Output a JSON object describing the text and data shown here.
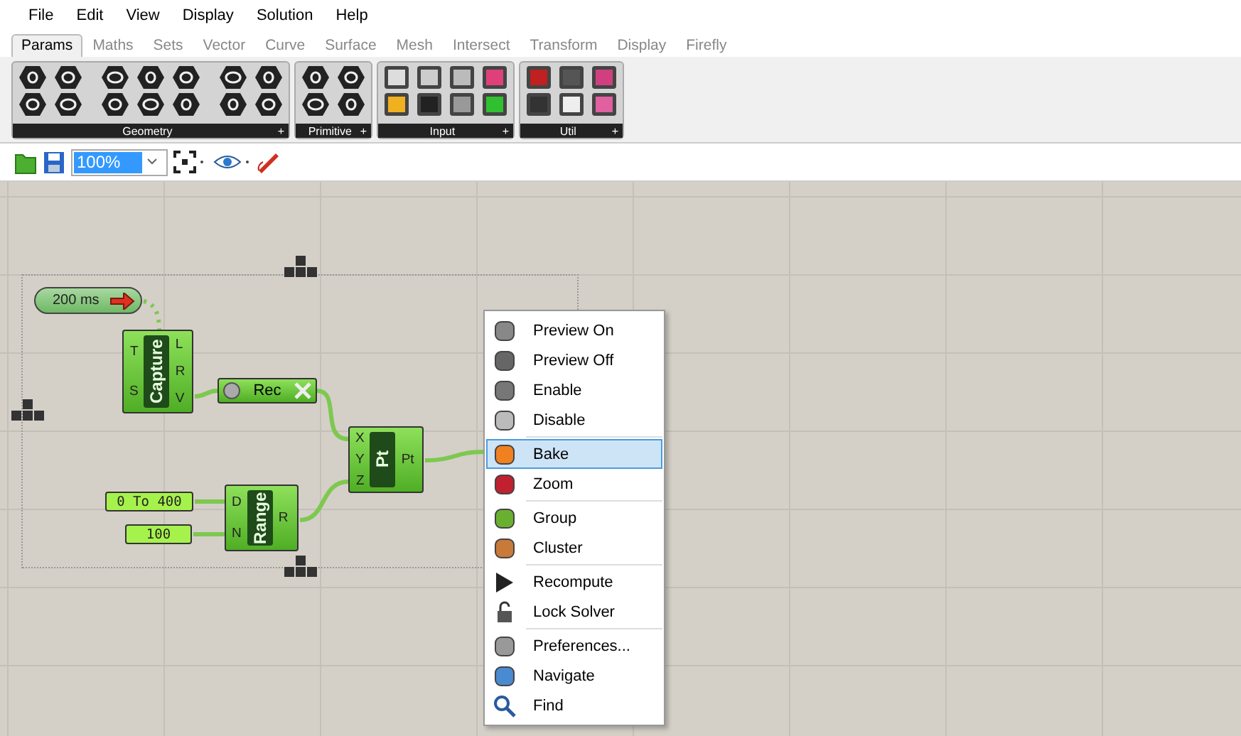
{
  "menu_bar": [
    "File",
    "Edit",
    "View",
    "Display",
    "Solution",
    "Help"
  ],
  "tabs": [
    {
      "label": "Params",
      "selected": true
    },
    {
      "label": "Maths",
      "selected": false
    },
    {
      "label": "Sets",
      "selected": false
    },
    {
      "label": "Vector",
      "selected": false
    },
    {
      "label": "Curve",
      "selected": false
    },
    {
      "label": "Surface",
      "selected": false
    },
    {
      "label": "Mesh",
      "selected": false
    },
    {
      "label": "Intersect",
      "selected": false
    },
    {
      "label": "Transform",
      "selected": false
    },
    {
      "label": "Display",
      "selected": false
    },
    {
      "label": "Firefly",
      "selected": false
    }
  ],
  "ribbon_groups": [
    {
      "label": "Geometry",
      "expand": "+"
    },
    {
      "label": "Primitive",
      "expand": "+"
    },
    {
      "label": "Input",
      "expand": "+"
    },
    {
      "label": "Util",
      "expand": "+"
    }
  ],
  "toolbar": {
    "zoom": "100%"
  },
  "canvas": {
    "timer": "200 ms",
    "components": [
      {
        "name": "Capture",
        "inputs": [
          "T",
          "S"
        ],
        "outputs": [
          "L",
          "R",
          "V"
        ]
      },
      {
        "name": "Pt",
        "inputs": [
          "X",
          "Y",
          "Z"
        ],
        "outputs": [
          "Pt"
        ]
      },
      {
        "name": "Range",
        "inputs": [
          "D",
          "N"
        ],
        "outputs": [
          "R"
        ]
      }
    ],
    "toggle": {
      "label": "Rec"
    },
    "panels": [
      "0 To 400",
      "100"
    ]
  },
  "context_menu": [
    [
      {
        "label": "Preview On",
        "selected": false
      },
      {
        "label": "Preview Off",
        "selected": false
      },
      {
        "label": "Enable",
        "selected": false
      },
      {
        "label": "Disable",
        "selected": false
      }
    ],
    [
      {
        "label": "Bake",
        "selected": true
      },
      {
        "label": "Zoom",
        "selected": false
      }
    ],
    [
      {
        "label": "Group",
        "selected": false
      },
      {
        "label": "Cluster",
        "selected": false
      }
    ],
    [
      {
        "label": "Recompute",
        "selected": false
      },
      {
        "label": "Lock Solver",
        "selected": false
      }
    ],
    [
      {
        "label": "Preferences...",
        "selected": false
      },
      {
        "label": "Navigate",
        "selected": false
      },
      {
        "label": "Find",
        "selected": false
      }
    ]
  ]
}
